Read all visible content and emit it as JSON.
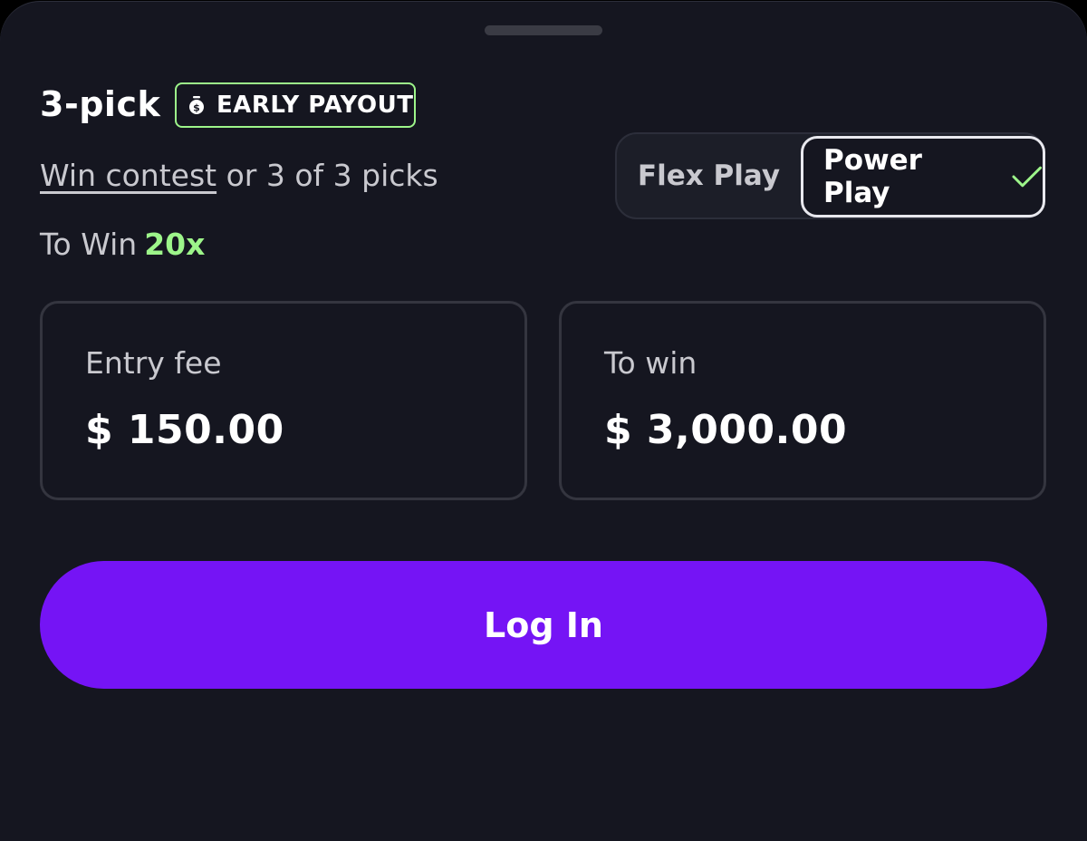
{
  "header": {
    "title": "3-pick",
    "badge": {
      "label": "EARLY PAYOUT",
      "icon": "money-bag-icon",
      "color": "#9df58a"
    }
  },
  "contest": {
    "win_link": "Win contest",
    "condition": "or 3 of 3 picks",
    "to_win_label": "To Win",
    "multiplier": "20x"
  },
  "play_toggle": {
    "options": [
      {
        "label": "Flex Play",
        "selected": false
      },
      {
        "label": "Power Play",
        "selected": true,
        "icon": "check-icon"
      }
    ]
  },
  "amounts": {
    "entry_fee": {
      "label": "Entry fee",
      "value": "$ 150.00"
    },
    "to_win": {
      "label": "To win",
      "value": "$ 3,000.00"
    }
  },
  "cta": {
    "label": "Log In",
    "color": "#7514f5"
  },
  "colors": {
    "background": "#151620",
    "accent_green": "#9df58a"
  }
}
